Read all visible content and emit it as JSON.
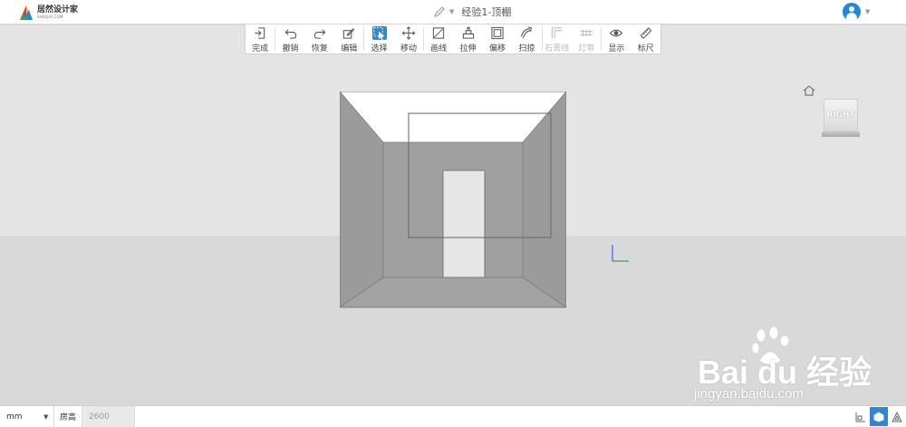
{
  "header": {
    "logo_text": "居然设计家",
    "logo_sub": "SHEJIJIA.COM",
    "doc_title": "经验1-顶棚"
  },
  "toolbar": {
    "items": [
      {
        "label": "完成",
        "icon": "finish-icon"
      },
      {
        "label": "撤销",
        "icon": "undo-icon"
      },
      {
        "label": "恢复",
        "icon": "redo-icon"
      },
      {
        "label": "编辑",
        "icon": "edit-icon"
      },
      {
        "label": "选择",
        "icon": "select-icon",
        "active": true
      },
      {
        "label": "移动",
        "icon": "move-icon"
      },
      {
        "label": "画线",
        "icon": "draw-line-icon"
      },
      {
        "label": "拉伸",
        "icon": "extrude-icon"
      },
      {
        "label": "偏移",
        "icon": "offset-icon"
      },
      {
        "label": "扫掠",
        "icon": "sweep-icon"
      },
      {
        "label": "石膏线",
        "icon": "plaster-line-icon",
        "disabled": true
      },
      {
        "label": "灯带",
        "icon": "light-strip-icon",
        "disabled": true
      },
      {
        "label": "显示",
        "icon": "display-icon"
      },
      {
        "label": "标尺",
        "icon": "ruler-icon"
      }
    ]
  },
  "viewcube": {
    "label": "RIGHT"
  },
  "watermark": {
    "brand": "Bai  du 经验",
    "url": "jingyan.baidu.com"
  },
  "statusbar": {
    "unit": "mm",
    "height_label": "房高",
    "height_value": "2600"
  },
  "colors": {
    "accent": "#2f86d6",
    "wall": "#9d9d9d",
    "floor": "#a3a3a3"
  }
}
